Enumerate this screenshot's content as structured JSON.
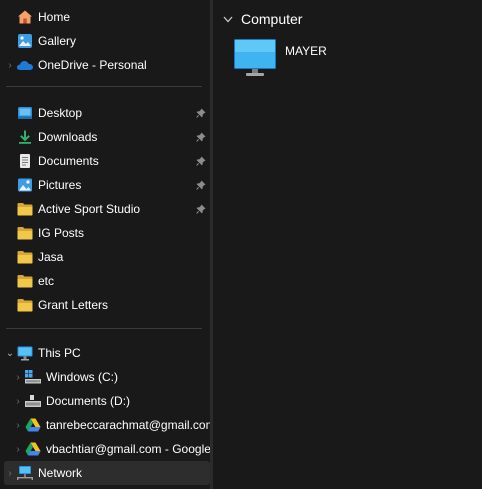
{
  "sidebar": {
    "top_items": [
      {
        "label": "Home",
        "icon": "home-icon"
      },
      {
        "label": "Gallery",
        "icon": "gallery-icon"
      },
      {
        "label": "OneDrive - Personal",
        "icon": "onedrive-icon"
      }
    ],
    "quick_access": [
      {
        "label": "Desktop",
        "icon": "desktop-folder-icon",
        "pinned": true
      },
      {
        "label": "Downloads",
        "icon": "downloads-icon",
        "pinned": true
      },
      {
        "label": "Documents",
        "icon": "documents-icon",
        "pinned": true
      },
      {
        "label": "Pictures",
        "icon": "pictures-icon",
        "pinned": true
      },
      {
        "label": "Active Sport Studio",
        "icon": "folder-icon",
        "pinned": true
      },
      {
        "label": "IG Posts",
        "icon": "folder-icon",
        "pinned": false
      },
      {
        "label": "Jasa",
        "icon": "folder-icon",
        "pinned": false
      },
      {
        "label": "etc",
        "icon": "folder-icon",
        "pinned": false
      },
      {
        "label": "Grant Letters",
        "icon": "folder-icon",
        "pinned": false
      }
    ],
    "this_pc": {
      "label": "This PC",
      "icon": "this-pc-icon",
      "expanded": true
    },
    "drives": [
      {
        "label": "Windows (C:)",
        "icon": "windows-drive-icon"
      },
      {
        "label": "Documents (D:)",
        "icon": "drive-icon"
      },
      {
        "label": "tanrebeccarachmat@gmail.com - Google Drive",
        "icon": "google-drive-icon"
      },
      {
        "label": "vbachtiar@gmail.com - Google Drive",
        "icon": "google-drive-icon"
      }
    ],
    "network": {
      "label": "Network",
      "icon": "network-icon",
      "selected": true
    }
  },
  "main": {
    "section_title": "Computer",
    "items": [
      {
        "label": "MAYER",
        "icon": "computer-monitor-icon"
      }
    ]
  },
  "colors": {
    "background": "#191919",
    "selected": "#2d2d2d",
    "folder": "#f2c84b",
    "accent_blue": "#1e90e0"
  }
}
